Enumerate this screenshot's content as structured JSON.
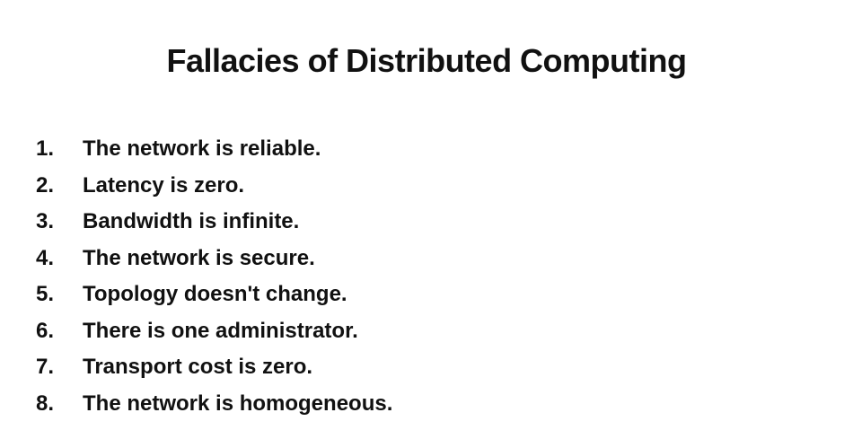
{
  "title": "Fallacies of Distributed Computing",
  "items": [
    {
      "number": "1.",
      "text": "The network is reliable."
    },
    {
      "number": "2.",
      "text": "Latency is zero."
    },
    {
      "number": "3.",
      "text": "Bandwidth is infinite."
    },
    {
      "number": "4.",
      "text": "The network is secure."
    },
    {
      "number": "5.",
      "text": "Topology doesn't change."
    },
    {
      "number": "6.",
      "text": "There is one administrator."
    },
    {
      "number": "7.",
      "text": "Transport cost is zero."
    },
    {
      "number": "8.",
      "text": "The network is homogeneous."
    }
  ]
}
